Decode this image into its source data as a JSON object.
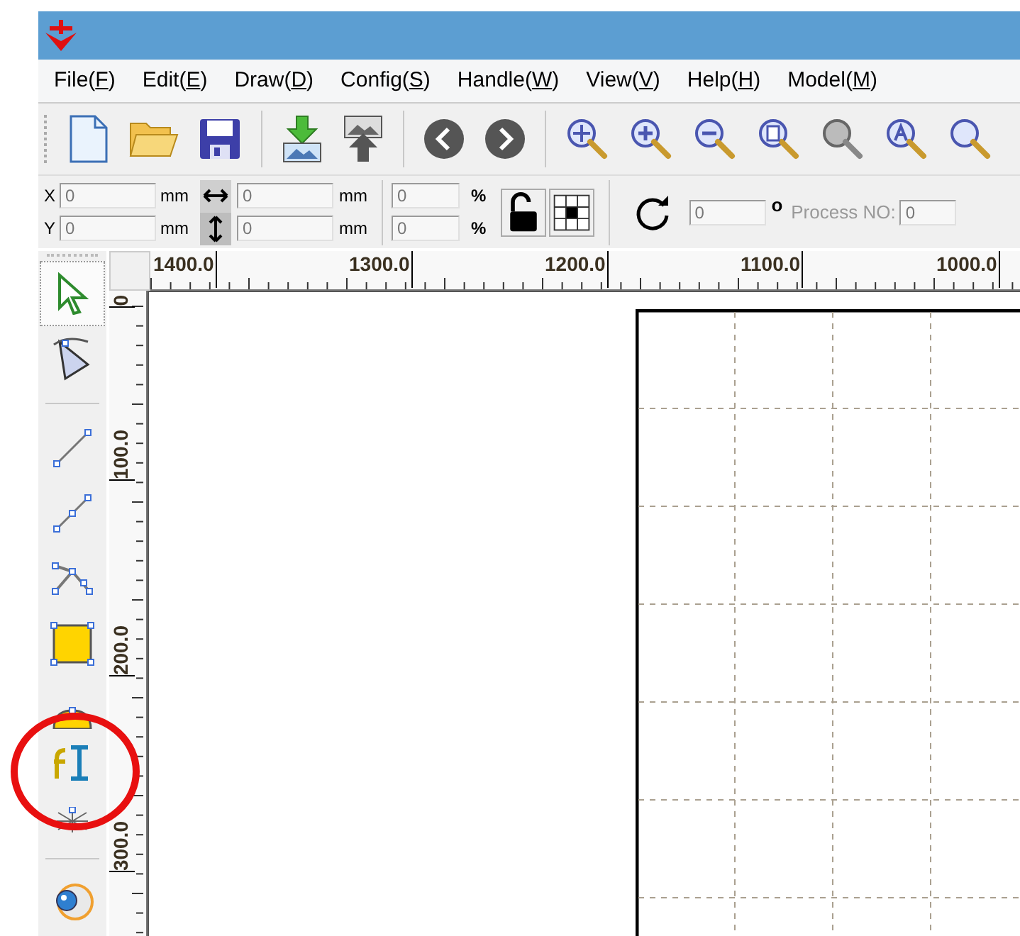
{
  "menu": [
    {
      "before": "File(",
      "mnemonic": "F",
      "after": ")"
    },
    {
      "before": "Edit(",
      "mnemonic": "E",
      "after": ")"
    },
    {
      "before": "Draw(",
      "mnemonic": "D",
      "after": ")"
    },
    {
      "before": "Config(",
      "mnemonic": "S",
      "after": ")"
    },
    {
      "before": "Handle(",
      "mnemonic": "W",
      "after": ")"
    },
    {
      "before": "View(",
      "mnemonic": "V",
      "after": ")"
    },
    {
      "before": "Help(",
      "mnemonic": "H",
      "after": ")"
    },
    {
      "before": "Model(",
      "mnemonic": "M",
      "after": ")"
    }
  ],
  "position": {
    "x_label": "X",
    "x_value": "0",
    "x_unit": "mm",
    "y_label": "Y",
    "y_value": "0",
    "y_unit": "mm"
  },
  "size": {
    "width_value": "0",
    "width_unit": "mm",
    "height_value": "0",
    "height_unit": "mm"
  },
  "scale": {
    "x_value": "0",
    "x_unit": "%",
    "y_value": "0",
    "y_unit": "%"
  },
  "rotation": {
    "value": "0",
    "unit": "o"
  },
  "process": {
    "label": "Process NO:",
    "value": "0",
    "disabled": true
  },
  "ruler": {
    "horizontal": [
      "1400.0",
      "1300.0",
      "1200.0",
      "1100.0",
      "1000.0"
    ],
    "vertical": [
      "0",
      "100.0",
      "200.0",
      "300.0"
    ]
  },
  "tools": [
    {
      "kind": "select",
      "selected": true
    },
    {
      "kind": "node",
      "selected": false
    },
    {
      "kind": "separator"
    },
    {
      "kind": "line",
      "selected": false
    },
    {
      "kind": "polyline",
      "selected": false
    },
    {
      "kind": "curve",
      "selected": false
    },
    {
      "kind": "rectangle",
      "selected": false
    },
    {
      "kind": "ellipse",
      "selected": false
    },
    {
      "kind": "text",
      "selected": false
    },
    {
      "kind": "point",
      "selected": false
    },
    {
      "kind": "separator"
    },
    {
      "kind": "camera",
      "selected": false
    }
  ]
}
